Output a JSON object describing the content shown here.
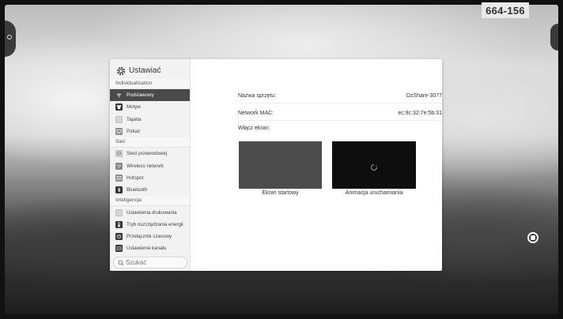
{
  "badge": {
    "code": "664-156"
  },
  "settings": {
    "title": "Ustawiać",
    "sections": [
      {
        "label": "Individualization"
      },
      {
        "label": "Sieć"
      },
      {
        "label": "Inteligencja"
      }
    ],
    "items": [
      {
        "label": "Podstawowy",
        "icon": "wifi-icon",
        "selected": true
      },
      {
        "label": "Motyw",
        "icon": "shirt-icon"
      },
      {
        "label": "Tapeta",
        "icon": "wallpaper-icon"
      },
      {
        "label": "Pokaz",
        "icon": "display-icon"
      },
      {
        "label": "Sieci przewodowej",
        "icon": "ethernet-icon"
      },
      {
        "label": "Wireless network",
        "icon": "wireless-icon"
      },
      {
        "label": "Hotspot",
        "icon": "hotspot-icon"
      },
      {
        "label": "Bluetooth",
        "icon": "bluetooth-icon"
      },
      {
        "label": "Ustawienia drukowania",
        "icon": "print-icon"
      },
      {
        "label": "Tryb oszczędzania energii",
        "icon": "power-save-icon"
      },
      {
        "label": "Przełącznik czasowy",
        "icon": "timer-icon"
      },
      {
        "label": "Ustawienie kanału",
        "icon": "channel-icon"
      }
    ],
    "search": {
      "placeholder": "Szukać"
    }
  },
  "main": {
    "device_name_label": "Nazwa sprzętu:",
    "device_name_value": "DzShare-3077",
    "mac_label": "Network MAC:",
    "mac_value": "ec:9c:32:7e:5b:31",
    "enable_screen_label": "Włącz ekran:",
    "startup_screen_label": "Ekran startowy",
    "boot_animation_label": "Animacja uruchamiania"
  }
}
